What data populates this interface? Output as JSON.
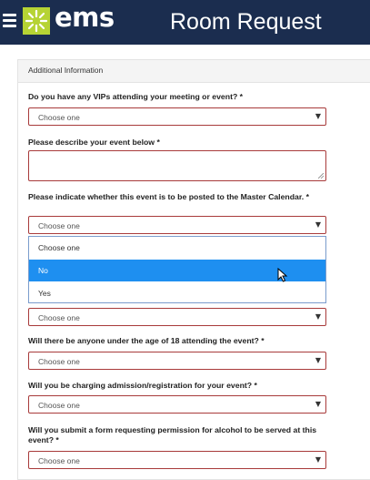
{
  "header": {
    "brand": "ems",
    "title": "Room Request",
    "logo_color": "#b6d334",
    "bg_color": "#1b2d4f"
  },
  "section": {
    "title": "Additional Information"
  },
  "questions": [
    {
      "label": "Do you have any VIPs attending your meeting or event? *",
      "value": "Choose one"
    },
    {
      "label": "Please describe your event below *",
      "value": ""
    },
    {
      "label": "Please indicate whether this event is to be posted to the Master Calendar. *",
      "value": "Choose one"
    },
    {
      "label": "",
      "value": "Choose one"
    },
    {
      "label": "Will there be anyone under the age of 18 attending the event? *",
      "value": "Choose one"
    },
    {
      "label": "Will you be charging admission/registration for your event? *",
      "value": "Choose one"
    },
    {
      "label": "Will you submit a form requesting permission for alcohol to be served at this event? *",
      "value": "Choose one"
    }
  ],
  "dropdown": {
    "options": [
      "Choose one",
      "No",
      "Yes"
    ],
    "highlighted": "No",
    "highlight_color": "#1e8ff0"
  },
  "invalid_border_color": "#a83a3a"
}
